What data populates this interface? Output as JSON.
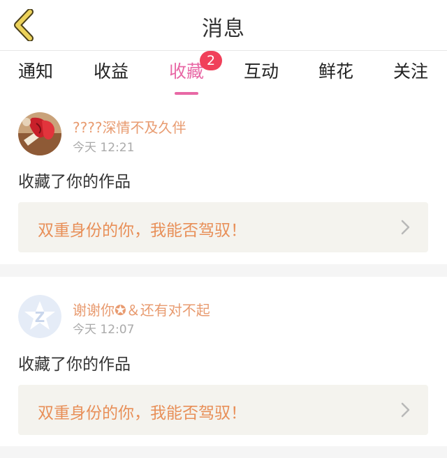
{
  "header": {
    "title": "消息",
    "back_icon": "chevron-left-icon"
  },
  "tabs": [
    {
      "label": "通知",
      "active": false
    },
    {
      "label": "收益",
      "active": false
    },
    {
      "label": "收藏",
      "active": true,
      "badge": "2"
    },
    {
      "label": "互动",
      "active": false
    },
    {
      "label": "鲜花",
      "active": false
    },
    {
      "label": "关注",
      "active": false
    }
  ],
  "messages": [
    {
      "username": "????深情不及久伴",
      "time": "今天 12:21",
      "action": "收藏了你的作品",
      "work_title": "双重身份的你，我能否驾驭！",
      "avatar": "photo-avatar"
    },
    {
      "username": "谢谢你✪＆还有对不起",
      "time": "今天 12:07",
      "action": "收藏了你的作品",
      "work_title": "双重身份的你，我能否驾驭！",
      "avatar": "default-avatar"
    }
  ],
  "colors": {
    "accent": "#e868a5",
    "badge": "#f0405a",
    "username": "#e89b70",
    "work_title": "#e88f58",
    "back_icon": "#e3c94a"
  }
}
